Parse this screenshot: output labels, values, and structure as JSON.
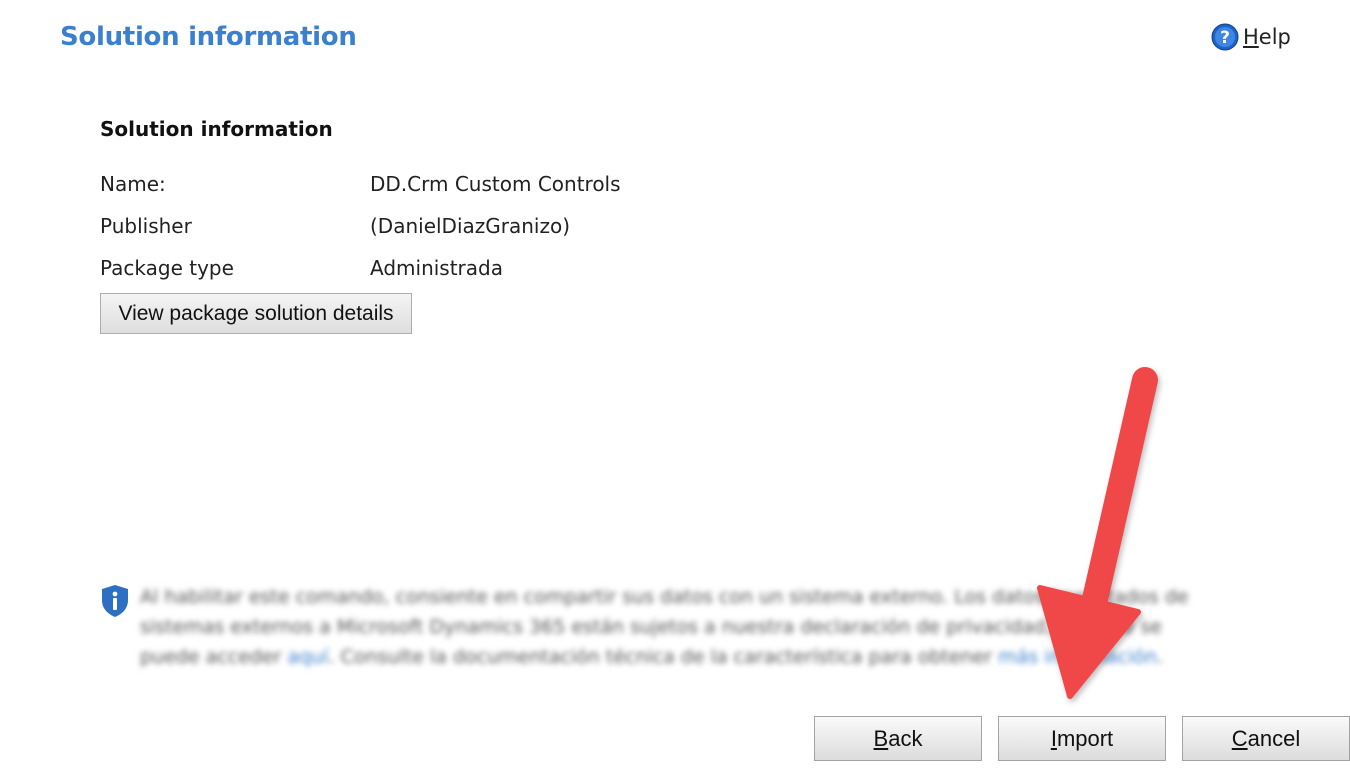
{
  "header": {
    "title": "Solution information",
    "help": {
      "mnemonic": "H",
      "rest": "elp",
      "icon": "help-icon"
    }
  },
  "solution": {
    "heading": "Solution information",
    "fields": [
      {
        "label": "Name:",
        "value": "DD.Crm Custom Controls"
      },
      {
        "label": "Publisher",
        "value": "(DanielDiazGranizo)"
      },
      {
        "label": "Package type",
        "value": "Administrada"
      }
    ],
    "details_button": "View package solution details"
  },
  "notice": {
    "icon": "shield-info-icon",
    "text_before_link1": "Al habilitar este comando, consiente en compartir sus datos con un sistema externo. Los datos importados de sistemas externos a Microsoft Dynamics 365 están sujetos a nuestra declaración de privacidad, a la que se puede acceder ",
    "link1": "aquí",
    "text_between": ". Consulte la documentación técnica de la característica para obtener ",
    "link2": "más información",
    "text_after": "."
  },
  "footer": {
    "back": {
      "mnemonic": "B",
      "rest": "ack"
    },
    "import": {
      "mnemonic": "I",
      "rest": "mport"
    },
    "cancel": {
      "mnemonic": "C",
      "rest": "ancel"
    }
  },
  "colors": {
    "accent": "#3b7fcd",
    "arrow": "#f0474a"
  }
}
